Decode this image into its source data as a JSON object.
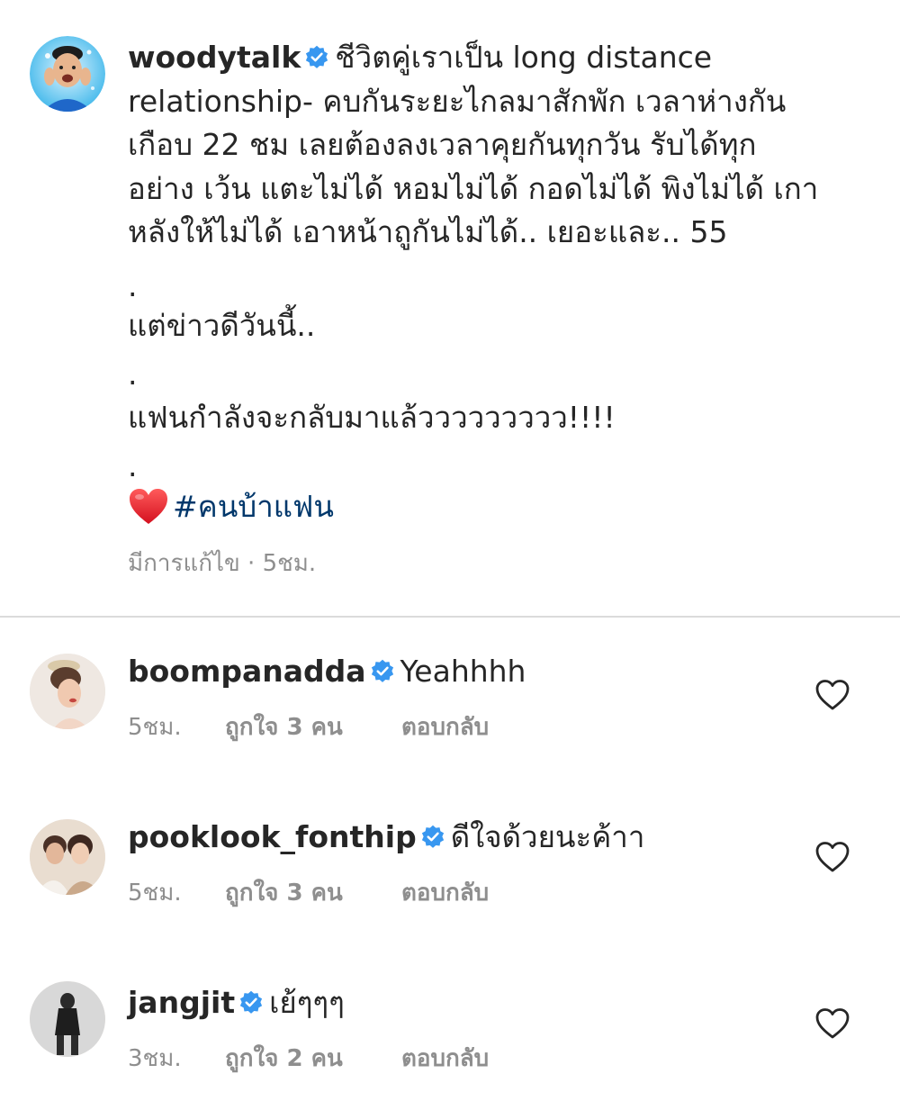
{
  "post": {
    "username": "woodytalk",
    "caption_first": "ชีวิตคู่เราเป็น long distance",
    "caption_lines": [
      "relationship- คบกันระยะไกลมาสักพัก เวลาห่างกัน",
      "เกือบ 22 ชม เลยต้องลงเวลาคุยกันทุกวัน รับได้ทุก",
      "อย่าง เว้น แตะไม่ได้ หอมไม่ได้ กอดไม่ได้ พิงไม่ได้ เกา",
      "หลังให้ไม่ได้ เอาหน้าถูกันไม่ได้.. เยอะและ.. 55"
    ],
    "dot": ".",
    "line_news": "แต่ข่าวดีวันนี้..",
    "line_back": "แฟนกำลังจะกลับมาแล้ววววววววว!!!!",
    "hashtag": "#คนบ้าแฟน",
    "edited_label": "มีการแก้ไข · 5ชม."
  },
  "comments": [
    {
      "username": "boompanadda",
      "text": "Yeahhhh",
      "time": "5ชม.",
      "likes": "ถูกใจ 3 คน",
      "reply": "ตอบกลับ"
    },
    {
      "username": "pooklook_fonthip",
      "text": "ดีใจด้วยนะค้าา",
      "time": "5ชม.",
      "likes": "ถูกใจ 3 คน",
      "reply": "ตอบกลับ"
    },
    {
      "username": "jangjit",
      "text": "เย้ๆๆๆ",
      "time": "3ชม.",
      "likes": "ถูกใจ 2 คน",
      "reply": "ตอบกลับ"
    }
  ],
  "icons": {
    "verified": "verified-badge-icon",
    "heart": "heart-outline-icon",
    "emoji": "red-heart-emoji"
  },
  "colors": {
    "text": "#262626",
    "muted": "#8e8e8e",
    "verified": "#3897f0",
    "hashtag": "#00376b",
    "divider": "#dbdbdb"
  }
}
